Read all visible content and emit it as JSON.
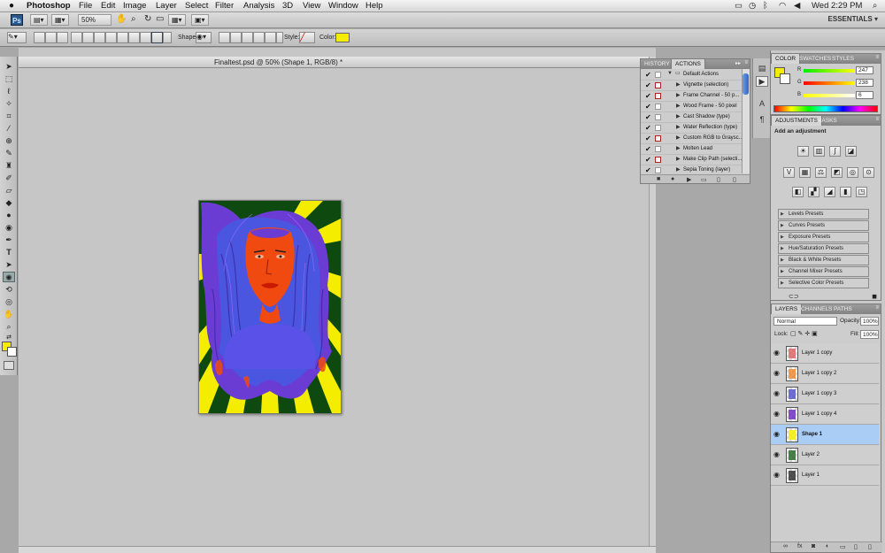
{
  "menubar": {
    "apple": "",
    "app": "Photoshop",
    "items": [
      "File",
      "Edit",
      "Image",
      "Layer",
      "Select",
      "Filter",
      "Analysis",
      "3D",
      "View",
      "Window",
      "Help"
    ],
    "clock": "Wed 2:29 PM"
  },
  "appbar": {
    "logo": "Ps",
    "zoom": "50%",
    "workspace": "ESSENTIALS ▾"
  },
  "options": {
    "shape_label": "Shape:",
    "style_label": "Style:",
    "color_label": "Color:",
    "color_value": "#f5ed00"
  },
  "document": {
    "title": "Finaltest.psd @ 50% (Shape 1, RGB/8) *"
  },
  "actions_panel": {
    "tabs": [
      "HISTORY",
      "ACTIONS"
    ],
    "active_tab": "ACTIONS",
    "items": [
      {
        "label": "Default Actions",
        "checked": true,
        "dialog": false,
        "folder": true
      },
      {
        "label": "Vignette (selection)",
        "checked": true,
        "dialog": true
      },
      {
        "label": "Frame Channel - 50 p...",
        "checked": true,
        "dialog": true
      },
      {
        "label": "Wood Frame - 50 pixel",
        "checked": true,
        "dialog": false
      },
      {
        "label": "Cast Shadow (type)",
        "checked": true,
        "dialog": false
      },
      {
        "label": "Water Reflection (type)",
        "checked": true,
        "dialog": false
      },
      {
        "label": "Custom RGB to Graysc...",
        "checked": true,
        "dialog": true
      },
      {
        "label": "Molten Lead",
        "checked": true,
        "dialog": false
      },
      {
        "label": "Make Clip Path (selecti...",
        "checked": true,
        "dialog": true
      },
      {
        "label": "Sepia Toning (layer)",
        "checked": true,
        "dialog": false
      }
    ]
  },
  "color_panel": {
    "tabs": [
      "COLOR",
      "SWATCHES",
      "STYLES"
    ],
    "active_tab": "COLOR",
    "r_label": "R",
    "g_label": "G",
    "b_label": "B",
    "r": "247",
    "g": "238",
    "b": "6",
    "foreground": "#f5ed00"
  },
  "adjustments_panel": {
    "tabs": [
      "ADJUSTMENTS",
      "MASKS"
    ],
    "active_tab": "ADJUSTMENTS",
    "heading": "Add an adjustment",
    "presets": [
      "Levels Presets",
      "Curves Presets",
      "Exposure Presets",
      "Hue/Saturation Presets",
      "Black & White Presets",
      "Channel Mixer Presets",
      "Selective Color Presets"
    ]
  },
  "layers_panel": {
    "tabs": [
      "LAYERS",
      "CHANNELS",
      "PATHS"
    ],
    "active_tab": "LAYERS",
    "blend_mode": "Normal",
    "opacity_label": "Opacity:",
    "opacity": "100%",
    "lock_label": "Lock:",
    "fill_label": "Fill:",
    "fill": "100%",
    "layers": [
      {
        "name": "Layer 1 copy",
        "selected": false,
        "thumb": "#d66"
      },
      {
        "name": "Layer 1 copy 2",
        "selected": false,
        "thumb": "#e83"
      },
      {
        "name": "Layer 1 copy 3",
        "selected": false,
        "thumb": "#55c"
      },
      {
        "name": "Layer 1 copy 4",
        "selected": false,
        "thumb": "#7030c0"
      },
      {
        "name": "Shape 1",
        "selected": true,
        "thumb": "#f5ed00"
      },
      {
        "name": "Layer 2",
        "selected": false,
        "thumb": "#2a6a2a"
      },
      {
        "name": "Layer 1",
        "selected": false,
        "thumb": "#333"
      }
    ]
  }
}
